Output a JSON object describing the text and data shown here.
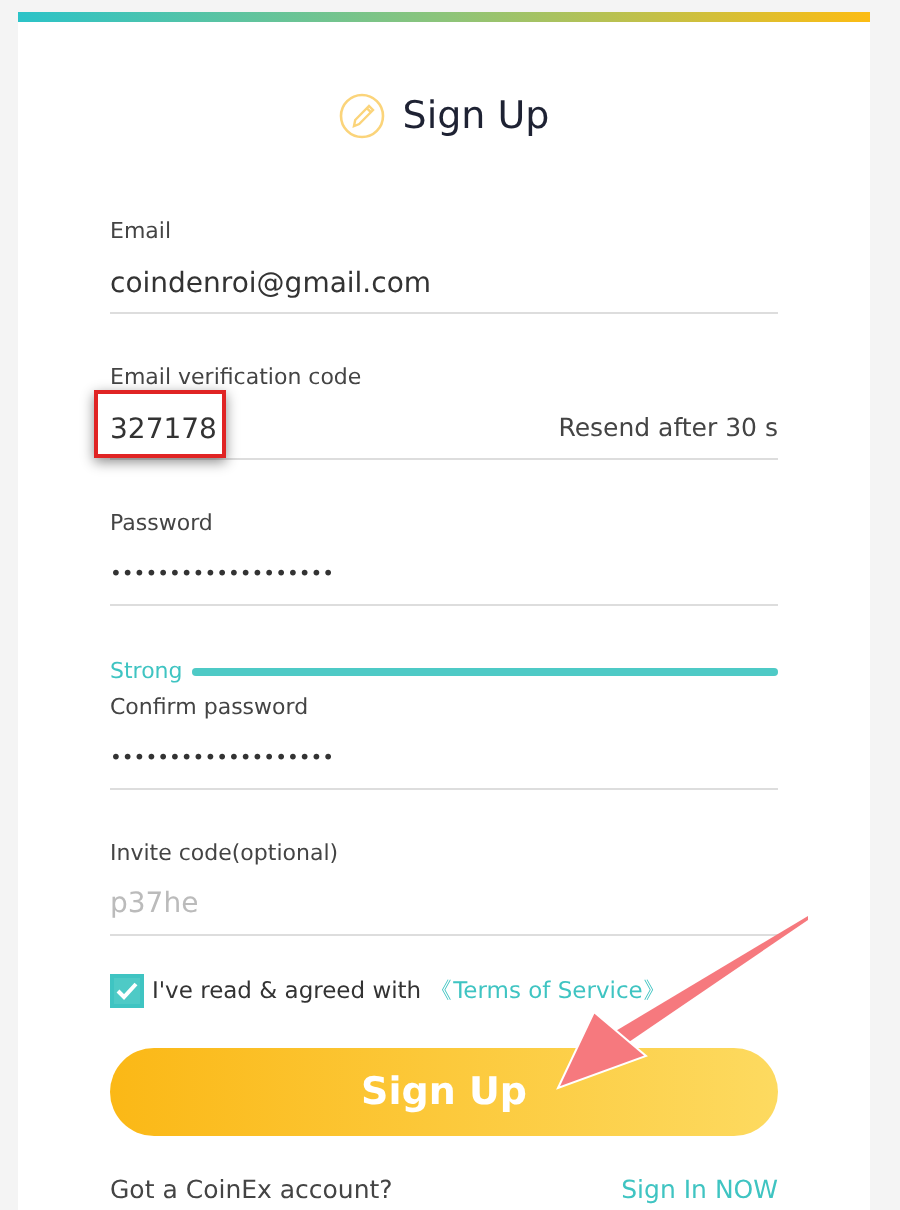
{
  "title": "Sign Up",
  "fields": [
    {
      "kind": "text",
      "label": "Email",
      "value": "coindenroi@gmail.com"
    },
    {
      "kind": "code",
      "label": "Email verification code",
      "value": "327178",
      "action": "Resend after 30 s",
      "highlighted": true
    },
    {
      "kind": "password",
      "label": "Password",
      "value": "•••••••••••••••••••",
      "strength": {
        "label": "Strong",
        "level": 1
      }
    },
    {
      "kind": "password",
      "label": "Confirm password",
      "value": "•••••••••••••••••••"
    },
    {
      "kind": "text",
      "label": "Invite code(optional)",
      "placeholder": "p37he"
    }
  ],
  "agreement": {
    "checked": true,
    "text": "I've read & agreed with",
    "link": "《Terms of Service》"
  },
  "submit": "Sign Up",
  "pointer_arrow": true,
  "footer": {
    "question": "Got a CoinEx account?",
    "link": "Sign In NOW"
  }
}
